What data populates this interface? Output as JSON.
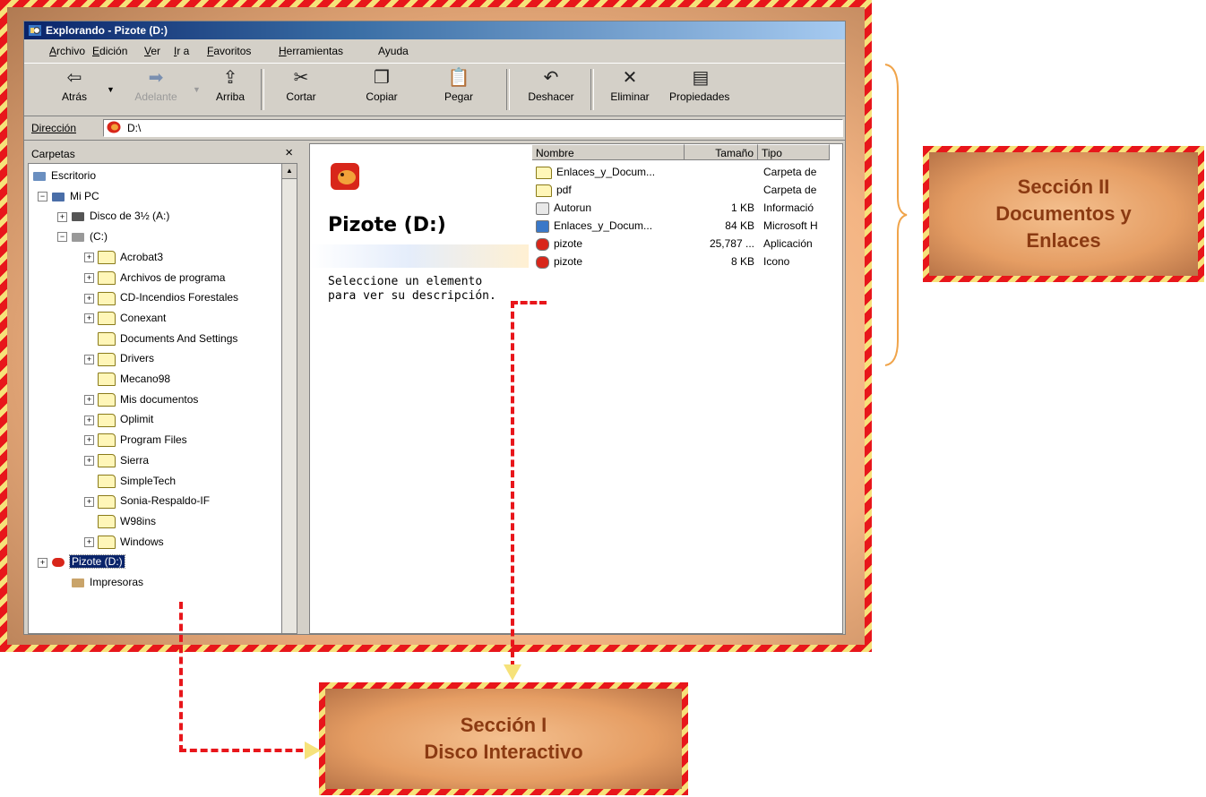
{
  "window": {
    "title": "Explorando - Pizote (D:)"
  },
  "menu": [
    {
      "u": "A",
      "rest": "rchivo"
    },
    {
      "u": "E",
      "rest": "dición"
    },
    {
      "u": "V",
      "rest": "er"
    },
    {
      "u": "I",
      "rest": "r a"
    },
    {
      "u": "F",
      "rest": "avoritos"
    },
    {
      "u": "H",
      "rest": "erramientas"
    },
    {
      "u": "",
      "rest": "Ayuda"
    }
  ],
  "toolbar": {
    "back": "Atrás",
    "forward": "Adelante",
    "up": "Arriba",
    "cut": "Cortar",
    "copy": "Copiar",
    "paste": "Pegar",
    "undo": "Deshacer",
    "delete": "Eliminar",
    "properties": "Propiedades"
  },
  "address": {
    "label": "Dirección",
    "value": "D:\\"
  },
  "folders": {
    "header": "Carpetas",
    "close": "×",
    "tree": [
      {
        "label": "Escritorio",
        "exp": "",
        "kind": "desktop"
      },
      {
        "label": "Mi PC",
        "exp": "−",
        "kind": "pc"
      },
      {
        "label": "Disco de 3½ (A:)",
        "exp": "+",
        "kind": "floppy"
      },
      {
        "label": "(C:)",
        "exp": "−",
        "kind": "hdd"
      },
      {
        "label": "Acrobat3",
        "exp": "+",
        "kind": "folder"
      },
      {
        "label": "Archivos de programa",
        "exp": "+",
        "kind": "folder"
      },
      {
        "label": "CD-Incendios Forestales",
        "exp": "+",
        "kind": "folder"
      },
      {
        "label": "Conexant",
        "exp": "+",
        "kind": "folder"
      },
      {
        "label": "Documents And Settings",
        "exp": "",
        "kind": "folder"
      },
      {
        "label": "Drivers",
        "exp": "+",
        "kind": "folder"
      },
      {
        "label": "Mecano98",
        "exp": "",
        "kind": "folder"
      },
      {
        "label": "Mis documentos",
        "exp": "+",
        "kind": "folder"
      },
      {
        "label": "Oplimit",
        "exp": "+",
        "kind": "folder"
      },
      {
        "label": "Program Files",
        "exp": "+",
        "kind": "folder"
      },
      {
        "label": "Sierra",
        "exp": "+",
        "kind": "folder"
      },
      {
        "label": "SimpleTech",
        "exp": "",
        "kind": "folder"
      },
      {
        "label": "Sonia-Respaldo-IF",
        "exp": "+",
        "kind": "folder"
      },
      {
        "label": "W98ins",
        "exp": "",
        "kind": "folder"
      },
      {
        "label": "Windows",
        "exp": "+",
        "kind": "folder"
      },
      {
        "label": "Pizote (D:)",
        "exp": "+",
        "kind": "pizote",
        "selected": true
      },
      {
        "label": "Impresoras",
        "exp": "",
        "kind": "printer"
      }
    ]
  },
  "info_panel": {
    "drive_name": "Pizote (D:)",
    "hint": "Seleccione un elemento para ver su descripción."
  },
  "file_list": {
    "columns": [
      "Nombre",
      "Tamaño",
      "Tipo"
    ],
    "rows": [
      {
        "name": "Enlaces_y_Docum...",
        "size": "",
        "type": "Carpeta de",
        "icon": "folder"
      },
      {
        "name": "pdf",
        "size": "",
        "type": "Carpeta de",
        "icon": "folder"
      },
      {
        "name": "Autorun",
        "size": "1 KB",
        "type": "Informació",
        "icon": "inf"
      },
      {
        "name": "Enlaces_y_Docum...",
        "size": "84 KB",
        "type": "Microsoft H",
        "icon": "ie"
      },
      {
        "name": "pizote",
        "size": "25,787 ...",
        "type": "Aplicación",
        "icon": "pizote"
      },
      {
        "name": "pizote",
        "size": "8 KB",
        "type": "Icono",
        "icon": "pizote"
      }
    ]
  },
  "callouts": {
    "section2": [
      "Sección II",
      "Documentos y",
      "Enlaces"
    ],
    "section1": [
      "Sección I",
      "Disco Interactivo"
    ]
  },
  "colors": {
    "stripe_red": "#e8161b",
    "stripe_yellow": "#f6e27a",
    "callout_text": "#8b3a12",
    "titlebar": "#0a246a"
  }
}
